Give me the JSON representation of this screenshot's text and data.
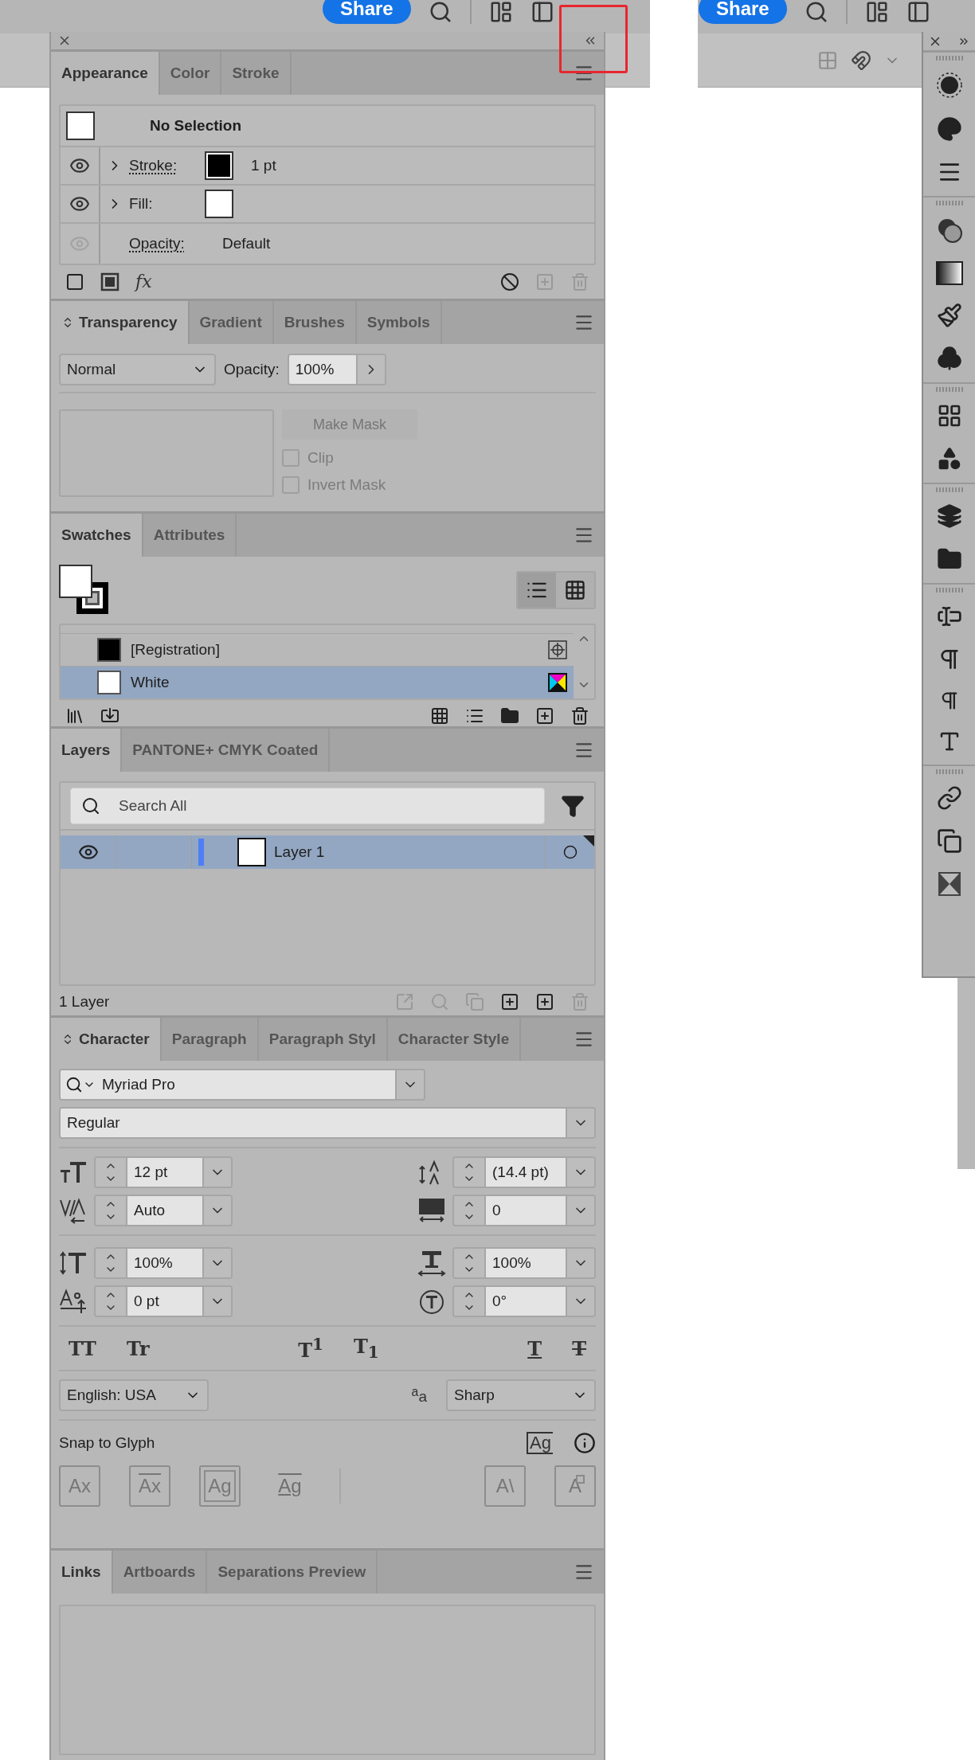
{
  "windows": [
    {
      "share": "Share"
    },
    {
      "share": "Share"
    }
  ],
  "appearance": {
    "tabs": [
      {
        "label": "Appearance",
        "selected": true,
        "collapsible": false
      },
      {
        "label": "Color",
        "selected": false,
        "collapsible": false
      },
      {
        "label": "Stroke",
        "selected": false,
        "collapsible": false
      }
    ],
    "title": "No Selection",
    "attributes": [
      {
        "kind": "stroke",
        "label": "Stroke:",
        "value": "1 pt",
        "visible": true
      },
      {
        "kind": "fill",
        "label": "Fill:",
        "visible": true
      },
      {
        "kind": "opacity",
        "label": "Opacity:",
        "value": "Default",
        "visible": false
      }
    ],
    "effect_button": "fx"
  },
  "transparency": {
    "tabs": [
      {
        "label": "Transparency",
        "selected": true,
        "collapsible": true
      },
      {
        "label": "Gradient",
        "selected": false,
        "collapsible": false
      },
      {
        "label": "Brushes",
        "selected": false,
        "collapsible": false
      },
      {
        "label": "Symbols",
        "selected": false,
        "collapsible": false
      }
    ],
    "blend_mode": "Normal",
    "opacity_label": "Opacity:",
    "opacity": "100%",
    "make_mask": {
      "label": "Make Mask",
      "disabled": true
    },
    "options": [
      {
        "label": "Clip",
        "checked": false,
        "disabled": true
      },
      {
        "label": "Invert Mask",
        "checked": false,
        "disabled": true
      }
    ]
  },
  "swatches": {
    "tabs": [
      {
        "label": "Swatches",
        "selected": true,
        "collapsible": false
      },
      {
        "label": "Attributes",
        "selected": false,
        "collapsible": false
      }
    ],
    "views": [
      {
        "kind": "list",
        "selected": true
      },
      {
        "kind": "grid",
        "selected": false
      }
    ],
    "rows": [
      {
        "name": "[Registration]",
        "kind": "registration",
        "color": "#000000",
        "selected": false
      },
      {
        "name": "White",
        "kind": "process",
        "color": "#ffffff",
        "selected": true
      }
    ]
  },
  "layers": {
    "tabs": [
      {
        "label": "Layers",
        "selected": true,
        "collapsible": false
      },
      {
        "label": "PANTONE+ CMYK Coated",
        "selected": false,
        "collapsible": false
      }
    ],
    "search": {
      "placeholder": "Search All"
    },
    "items": [
      {
        "name": "Layer 1",
        "visible": true,
        "selected": true,
        "color": "#4f7df5"
      }
    ],
    "count": "1 Layer"
  },
  "character": {
    "tabs": [
      {
        "label": "Character",
        "selected": true,
        "collapsible": true
      },
      {
        "label": "Paragraph",
        "selected": false,
        "collapsible": false
      },
      {
        "label": "Paragraph Styl",
        "selected": false,
        "collapsible": false
      },
      {
        "label": "Character Style",
        "selected": false,
        "collapsible": false
      }
    ],
    "font": "Myriad Pro",
    "style": "Regular",
    "fields": [
      {
        "kind": "size",
        "value": "12 pt"
      },
      {
        "kind": "leading",
        "value": "(14.4 pt)"
      },
      {
        "kind": "kerning",
        "value": "Auto"
      },
      {
        "kind": "tracking",
        "value": "0"
      },
      {
        "kind": "vertical_scale",
        "value": "100%"
      },
      {
        "kind": "horizontal_scale",
        "value": "100%"
      },
      {
        "kind": "baseline_shift",
        "value": "0 pt"
      },
      {
        "kind": "rotation",
        "value": "0°"
      }
    ],
    "type_buttons": [
      {
        "label": "TT",
        "kind": "plain"
      },
      {
        "label": "Tr",
        "kind": "plain"
      },
      {
        "label": "T$^{1}$",
        "kind": "plain"
      },
      {
        "label": "T$_{1}$",
        "kind": "plain"
      },
      {
        "label": "T",
        "kind": "underline"
      },
      {
        "label": "T",
        "kind": "strikethrough"
      }
    ],
    "language": "English: USA",
    "antialias_label": "$^{a}$a",
    "antialias": "Sharp",
    "snap_label": "Snap to Glyph",
    "snap_icon": "Ag",
    "snap_buttons": [
      {
        "label": "Ax",
        "kind": "boxed"
      },
      {
        "label": "Ax",
        "kind": "struck"
      },
      {
        "label": "Ag",
        "kind": "framed"
      },
      {
        "label": "Ag",
        "kind": "bare"
      },
      {
        "label": "A\\",
        "kind": "boxed"
      },
      {
        "label": "A",
        "kind": "marked"
      }
    ]
  },
  "links": {
    "tabs": [
      {
        "label": "Links",
        "selected": true,
        "collapsible": false
      },
      {
        "label": "Artboards",
        "selected": false,
        "collapsible": false
      },
      {
        "label": "Separations Preview",
        "selected": false,
        "collapsible": false
      }
    ]
  }
}
